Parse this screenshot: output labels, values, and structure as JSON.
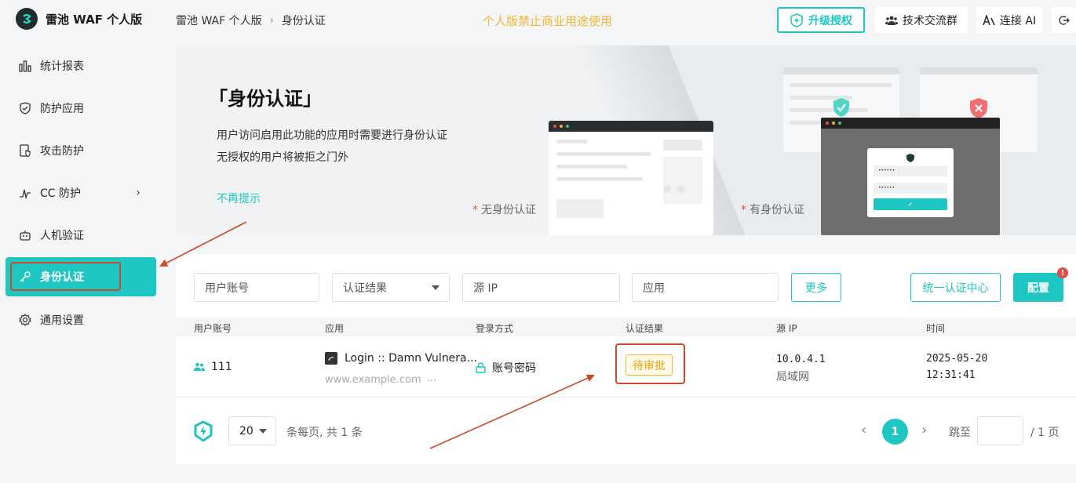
{
  "app": {
    "name": "雷池 WAF 个人版"
  },
  "sidebar": {
    "items": [
      {
        "label": "统计报表",
        "icon": "bar-chart-icon"
      },
      {
        "label": "防护应用",
        "icon": "shield-icon"
      },
      {
        "label": "攻击防护",
        "icon": "document-shield-icon"
      },
      {
        "label": "CC 防护",
        "icon": "pulse-icon"
      },
      {
        "label": "人机验证",
        "icon": "robot-icon"
      },
      {
        "label": "身份认证",
        "icon": "key-icon",
        "active": true
      },
      {
        "label": "通用设置",
        "icon": "gear-icon"
      }
    ]
  },
  "header": {
    "breadcrumb": [
      "雷池 WAF 个人版",
      "身份认证"
    ],
    "notice": "个人版禁止商业用途使用",
    "upgrade_label": "升级授权",
    "group_label": "技术交流群",
    "ai_label": "连接 AI"
  },
  "banner": {
    "title": "「身份认证」",
    "desc_line1": "用户访问启用此功能的应用时需要进行身份认证",
    "desc_line2": "无授权的用户将被拒之门外",
    "dismiss_label": "不再提示",
    "caption_without": "无身份认证",
    "caption_with": "有身份认证",
    "caption_marker": "*",
    "mock_password_1": "••••••",
    "mock_password_2": "••••••",
    "mock_submit": "✓"
  },
  "filters": {
    "account_placeholder": "用户账号",
    "result_label": "认证结果",
    "source_ip_placeholder": "源 IP",
    "app_placeholder": "应用",
    "more_label": "更多",
    "sso_label": "统一认证中心",
    "config_label": "配置",
    "config_badge": "!"
  },
  "table": {
    "columns": [
      "用户账号",
      "应用",
      "登录方式",
      "认证结果",
      "源 IP",
      "时间"
    ],
    "rows": [
      {
        "account": "111",
        "app_name": "Login :: Damn Vulnera...",
        "app_domain": "www.example.com",
        "app_more": "...",
        "login_method": "账号密码",
        "result": "待审批",
        "ip": "10.0.4.1",
        "network": "局域网",
        "date": "2025-05-20",
        "time": "12:31:41"
      }
    ]
  },
  "pagination": {
    "page_size": "20",
    "summary": "条每页, 共 1 条",
    "current_page": "1",
    "prev": "‹",
    "next": "›",
    "goto_label": "跳至",
    "total_pages": "/ 1 页"
  },
  "colors": {
    "accent": "#1ec6c1",
    "warning": "#f1b631",
    "annotation": "#c9492c"
  }
}
